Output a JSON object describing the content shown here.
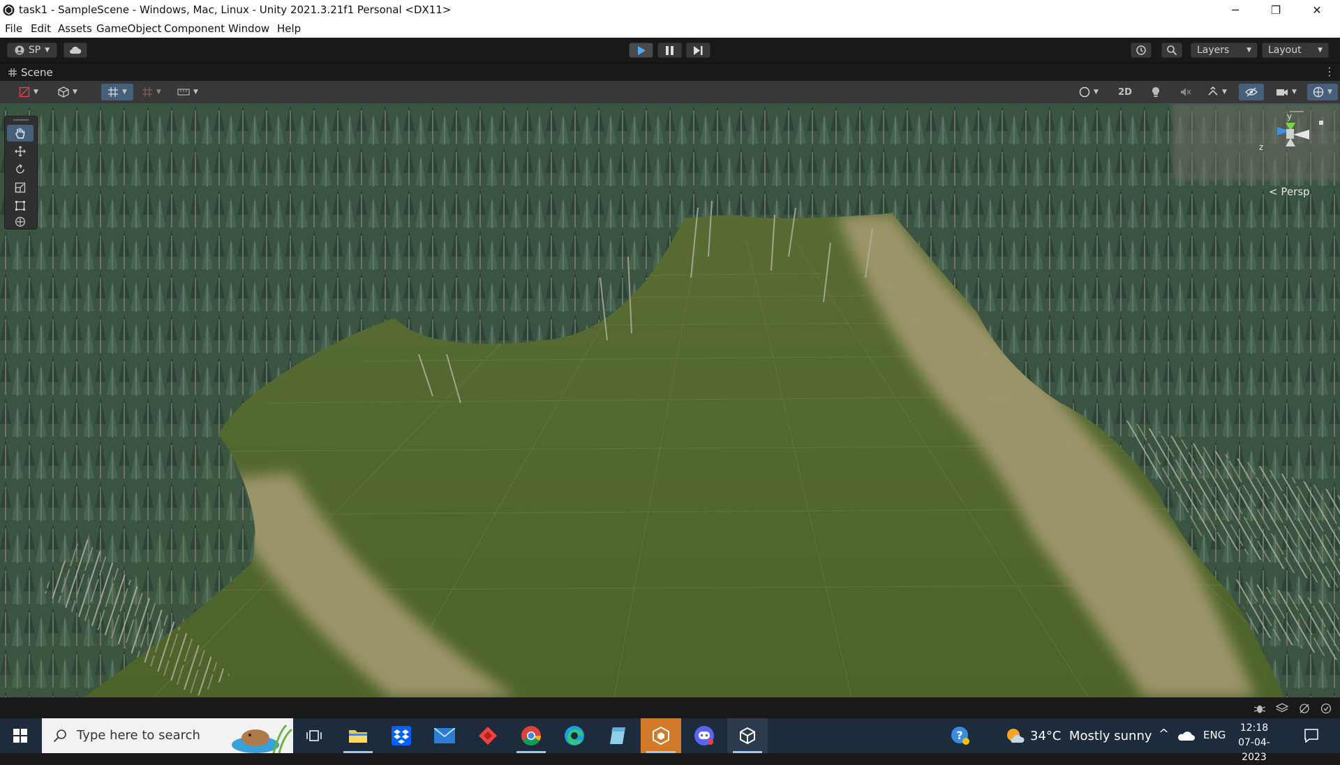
{
  "window": {
    "title": "task1 - SampleScene - Windows, Mac, Linux - Unity 2021.3.21f1 Personal <DX11>",
    "minimize": "─",
    "maximize": "❐",
    "close": "✕"
  },
  "menu": [
    "File",
    "Edit",
    "Assets",
    "GameObject",
    "Component",
    "Window",
    "Help"
  ],
  "toolbar": {
    "account_label": "SP",
    "layers_label": "Layers",
    "layout_label": "Layout"
  },
  "scene_tab": {
    "label": "Scene"
  },
  "scene_toolbar": {
    "twod_label": "2D"
  },
  "gizmo": {
    "y_label": "y",
    "z_label": "z",
    "projection_label": "< Persp"
  },
  "taskbar": {
    "search_placeholder": "Type here to search",
    "weather": "34°C  Mostly sunny",
    "language": "ENG",
    "time": "12:18",
    "date": "07-04-2023"
  },
  "colors": {
    "terrain_green": "#53672d",
    "path_sand": "#a49a70",
    "tree_foliage": "#2f4a3a",
    "taskbar_bg": "#1e2b3c",
    "unity_active_tool": "#46607c"
  }
}
